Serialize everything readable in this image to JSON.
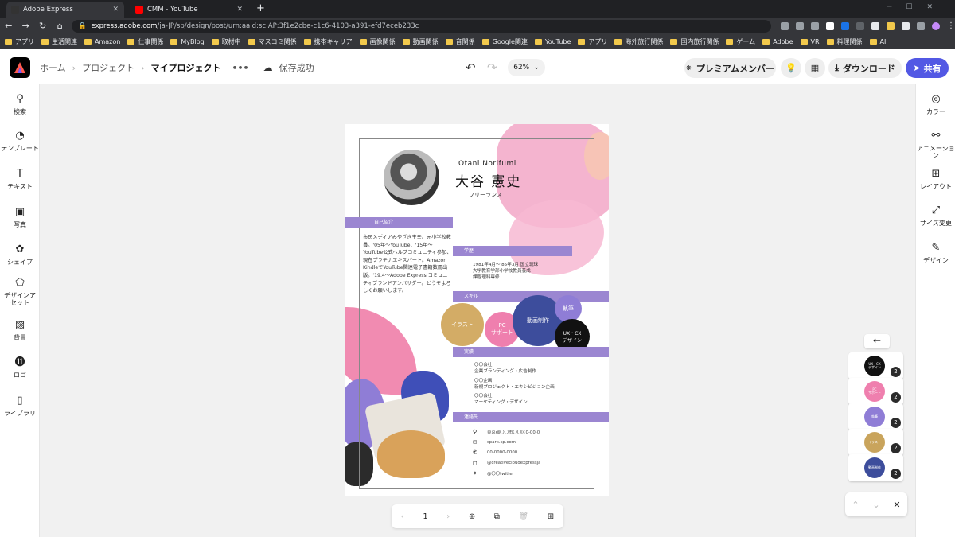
{
  "browser": {
    "tabs": [
      {
        "title": "Adobe Express",
        "active": true
      },
      {
        "title": "CMM - YouTube",
        "active": false
      }
    ],
    "url_host": "express.adobe.com",
    "url_path": "/ja-JP/sp/design/post/urn:aaid:sc:AP:3f1e2cbe-c1c6-4103-a391-efd7eceb233c",
    "bookmarks": [
      "アプリ",
      "生活関連",
      "Amazon",
      "仕事関係",
      "MyBlog",
      "取材中",
      "マスコミ関係",
      "携帯キャリア",
      "画像関係",
      "動画関係",
      "音関係",
      "Google関連",
      "YouTube",
      "アプリ",
      "海外旅行関係",
      "国内旅行関係",
      "ゲーム",
      "Adobe",
      "VR",
      "料理関係",
      "AI"
    ]
  },
  "header": {
    "breadcrumb": [
      "ホーム",
      "プロジェクト",
      "マイプロジェクト"
    ],
    "more": "•••",
    "save_status": "保存成功",
    "zoom": "62%",
    "premium": "プレミアムメンバー",
    "download": "ダウンロード",
    "share": "共有"
  },
  "left_rail": [
    "検索",
    "テンプレート",
    "テキスト",
    "写真",
    "シェイプ",
    "デザインアセット",
    "背景",
    "ロゴ",
    "ライブラリ"
  ],
  "right_rail": [
    "カラー",
    "アニメーション",
    "レイアウト",
    "サイズ変更",
    "デザイン"
  ],
  "document": {
    "name_romaji": "Otani    Norifumi",
    "name_jp": "大谷 憲史",
    "role": "フリーランス",
    "sections": {
      "intro": "自己紹介",
      "education": "学歴",
      "skills": "スキル",
      "achievements": "実績",
      "contact": "連絡先"
    },
    "intro_text": "市民メディアみやざき主宰。元小学校教員。'05年〜YouTube、'15年〜YouTube公式ヘルプコミュニティ参加、現在プラチナエキスパート。Amazon KindleでYouTube関連電子書籍数冊出版。'19.4〜Adobe Express コミュニティブランドアンバサダー。どうぞよろしくお願いします。",
    "education_lines": [
      "1981年4月〜'85年3月 国立琉球",
      "大学教育学部小学校教員養成",
      "課程理科専修"
    ],
    "skills": [
      "イラスト",
      "PC\nサポート",
      "動画制作",
      "執筆",
      "UX・CX\nデザイン"
    ],
    "achievements": [
      [
        "〇〇会社",
        "企業ブランディング・広告制作"
      ],
      [
        "〇〇企画",
        "新規プロジェクト・エキシビジョン企画"
      ],
      [
        "〇〇会社",
        "マーケティング・デザイン"
      ]
    ],
    "contact": [
      "東京都〇〇市〇〇区0-00-0",
      "spark.sp.com",
      "00-0000-0000",
      "@creativecloudexpressja",
      "@〇〇twitter"
    ]
  },
  "pagebar": {
    "page": "1"
  },
  "layers": [
    {
      "label": "UX・CX\nデザイン",
      "count": "2",
      "color": "#111111"
    },
    {
      "label": "PC\nサポート",
      "count": "2",
      "color": "#ef7fae"
    },
    {
      "label": "執筆",
      "count": "2",
      "color": "#8f7dd6"
    },
    {
      "label": "イラスト",
      "count": "2",
      "color": "#c9a45c"
    },
    {
      "label": "動画制作",
      "count": "2",
      "color": "#3d4d9c"
    }
  ],
  "colors": {
    "accent": "#5258e4",
    "section_bar": "#9b86d1",
    "pink": "#ef7fae",
    "navy": "#3d4d9c"
  }
}
